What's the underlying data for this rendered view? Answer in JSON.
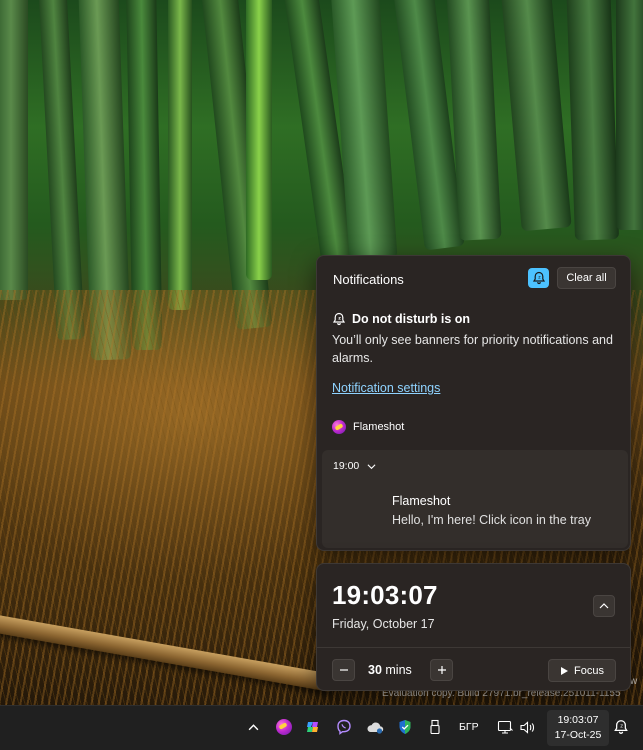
{
  "desktop": {
    "watermark": "Evaluation copy. Build 27971.br_release.251011-1155",
    "watermark_edge_fragment": "w"
  },
  "notifications": {
    "header": "Notifications",
    "clear_all_label": "Clear all",
    "dnd_title": "Do not disturb is on",
    "dnd_description": "You’ll only see banners for priority notifications and alarms.",
    "settings_link": "Notification settings",
    "app_name": "Flameshot",
    "notification": {
      "time": "19:00",
      "title": "Flameshot",
      "body": "Hello, I'm here! Click icon in the tray"
    }
  },
  "clock": {
    "time": "19:03:07",
    "date": "Friday, October 17",
    "focus_duration": "30",
    "focus_unit": "mins",
    "focus_button_label": "Focus"
  },
  "taskbar": {
    "language": "БГР",
    "time": "19:03:07",
    "date": "17-Oct-25"
  },
  "colors": {
    "accent": "#4cc2ff",
    "link": "#8fd3ff",
    "panel": "#2a2523",
    "taskbar": "#202020"
  },
  "icons": {
    "dnd_toggle": "bell-sleep-icon",
    "dnd_title": "bell-sleep-icon",
    "app": "flameshot-icon",
    "expand": "chevron-down-icon",
    "collapse": "chevron-up-icon",
    "minus": "minus-icon",
    "plus": "plus-icon",
    "focus": "play-icon",
    "tray": [
      "chevron-up-icon",
      "flameshot-icon",
      "copilot-icon",
      "viber-icon",
      "onedrive-icon",
      "defender-icon",
      "usb-icon",
      "display-icon",
      "volume-icon",
      "bell-sleep-icon"
    ]
  }
}
